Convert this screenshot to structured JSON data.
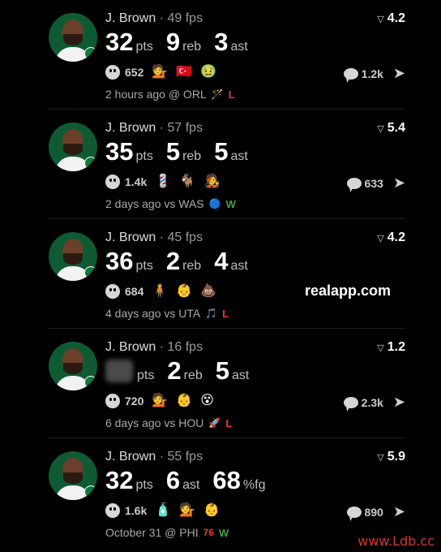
{
  "feed": [
    {
      "player": "J. Brown",
      "fps": "· 49 fps",
      "score": "4.2",
      "stats": [
        {
          "num": "32",
          "unit": "pts"
        },
        {
          "num": "9",
          "unit": "reb"
        },
        {
          "num": "3",
          "unit": "ast"
        }
      ],
      "reactions_count": "652",
      "emojis": [
        "💁",
        "🇹🇷",
        "🤢"
      ],
      "comments": "1.2k",
      "game": "2 hours ago @ ORL",
      "opp_logo": "🪄",
      "result": "L"
    },
    {
      "player": "J. Brown",
      "fps": "· 57 fps",
      "score": "5.4",
      "stats": [
        {
          "num": "35",
          "unit": "pts"
        },
        {
          "num": "5",
          "unit": "reb"
        },
        {
          "num": "5",
          "unit": "ast"
        }
      ],
      "reactions_count": "1.4k",
      "emojis": [
        "💈",
        "🐐",
        "🧑‍🎤"
      ],
      "comments": "633",
      "game": "2 days ago vs WAS",
      "opp_logo": "🔵",
      "result": "W"
    },
    {
      "player": "J. Brown",
      "fps": "· 45 fps",
      "score": "4.2",
      "stats": [
        {
          "num": "36",
          "unit": "pts"
        },
        {
          "num": "2",
          "unit": "reb"
        },
        {
          "num": "4",
          "unit": "ast"
        }
      ],
      "reactions_count": "684",
      "emojis": [
        "🧍",
        "👶",
        "💩"
      ],
      "watermark": "realapp.com",
      "game": "4 days ago vs UTA",
      "opp_logo": "🎵",
      "result": "L"
    },
    {
      "player": "J. Brown",
      "fps": "· 16 fps",
      "score": "1.2",
      "stats": [
        {
          "num": "",
          "unit": "pts"
        },
        {
          "num": "2",
          "unit": "reb"
        },
        {
          "num": "5",
          "unit": "ast"
        }
      ],
      "reactions_count": "720",
      "emojis": [
        "💁",
        "👶",
        "😵"
      ],
      "comments": "2.3k",
      "game": "6 days ago vs HOU",
      "opp_logo": "🚀",
      "result": "L"
    },
    {
      "player": "J. Brown",
      "fps": "· 55 fps",
      "score": "5.9",
      "stats": [
        {
          "num": "32",
          "unit": "pts"
        },
        {
          "num": "6",
          "unit": "ast"
        },
        {
          "num": "68",
          "unit": "%fg"
        }
      ],
      "reactions_count": "1.6k",
      "emojis": [
        "🧴",
        "💁",
        "👶"
      ],
      "comments": "890",
      "game": "October 31 @ PHI",
      "opp_logo": "76",
      "result": "W"
    }
  ],
  "site_watermark": "www.Ldb.cc",
  "colors": {
    "loss": "#e53935",
    "win": "#43a047",
    "background": "#000000"
  }
}
